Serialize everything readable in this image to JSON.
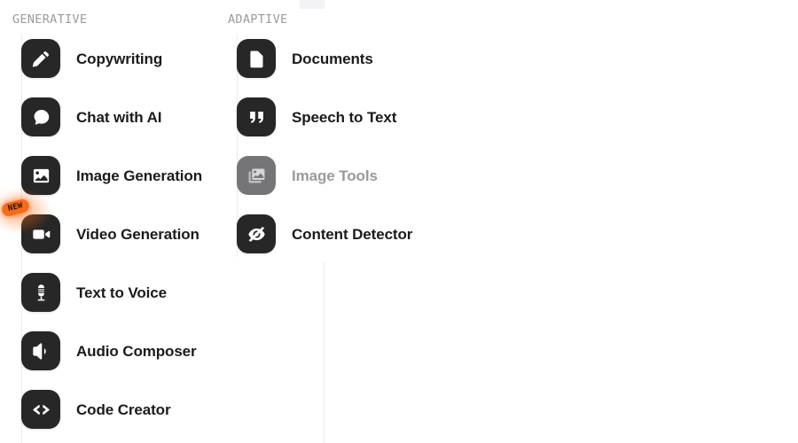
{
  "columns": [
    {
      "id": "generative",
      "header": "GENERATIVE",
      "items": [
        {
          "label": "Copywriting",
          "icon": "pencil-icon",
          "disabled": false,
          "badge": null
        },
        {
          "label": "Chat with AI",
          "icon": "chat-bubble-icon",
          "disabled": false,
          "badge": null
        },
        {
          "label": "Image Generation",
          "icon": "image-icon",
          "disabled": false,
          "badge": null
        },
        {
          "label": "Video Generation",
          "icon": "video-camera-icon",
          "disabled": false,
          "badge": "NEW"
        },
        {
          "label": "Text to Voice",
          "icon": "microphone-icon",
          "disabled": false,
          "badge": null
        },
        {
          "label": "Audio Composer",
          "icon": "speaker-icon",
          "disabled": false,
          "badge": null
        },
        {
          "label": "Code Creator",
          "icon": "code-brackets-icon",
          "disabled": false,
          "badge": null
        }
      ]
    },
    {
      "id": "adaptive",
      "header": "ADAPTIVE",
      "items": [
        {
          "label": "Documents",
          "icon": "document-icon",
          "disabled": false,
          "badge": null
        },
        {
          "label": "Speech to Text",
          "icon": "quote-marks-icon",
          "disabled": false,
          "badge": null
        },
        {
          "label": "Image Tools",
          "icon": "photo-stack-icon",
          "disabled": true,
          "badge": null
        },
        {
          "label": "Content Detector",
          "icon": "eye-slash-icon",
          "disabled": false,
          "badge": null
        }
      ]
    }
  ],
  "colors": {
    "background": "#ffffff",
    "tile": "#272727",
    "tile_disabled": "#757578",
    "label": "#1b1b1b",
    "label_disabled": "#9a9a9e",
    "header": "#9b9b9f",
    "badge_accent": "#f96a18",
    "rule": "#ececee"
  }
}
